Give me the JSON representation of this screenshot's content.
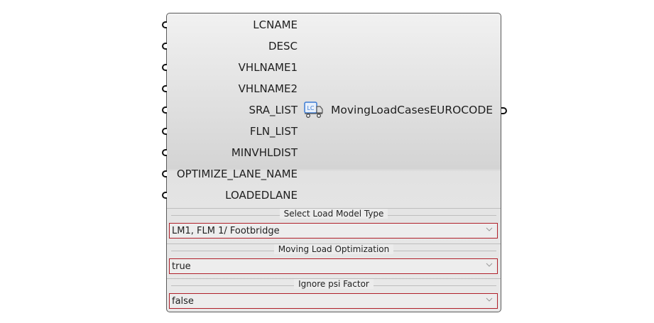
{
  "component": {
    "title": "MovingLoadCasesEUROCODE",
    "icon": "lc-truck-icon",
    "icon_text": "LC",
    "inputs": [
      {
        "label": "LCNAME"
      },
      {
        "label": "DESC"
      },
      {
        "label": "VHLNAME1"
      },
      {
        "label": "VHLNAME2"
      },
      {
        "label": "SRA_LIST"
      },
      {
        "label": "FLN_LIST"
      },
      {
        "label": "MINVHLDIST"
      },
      {
        "label": "OPTIMIZE_LANE_NAME"
      },
      {
        "label": "LOADEDLANE"
      }
    ],
    "sections": [
      {
        "title": "Select Load Model Type",
        "value": "LM1, FLM 1/ Footbridge"
      },
      {
        "title": "Moving Load Optimization",
        "value": "true"
      },
      {
        "title": "Ignore psi Factor",
        "value": "false"
      }
    ],
    "colors": {
      "dropdown_border": "#b0202a",
      "icon_blue": "#3a7bd5"
    }
  }
}
